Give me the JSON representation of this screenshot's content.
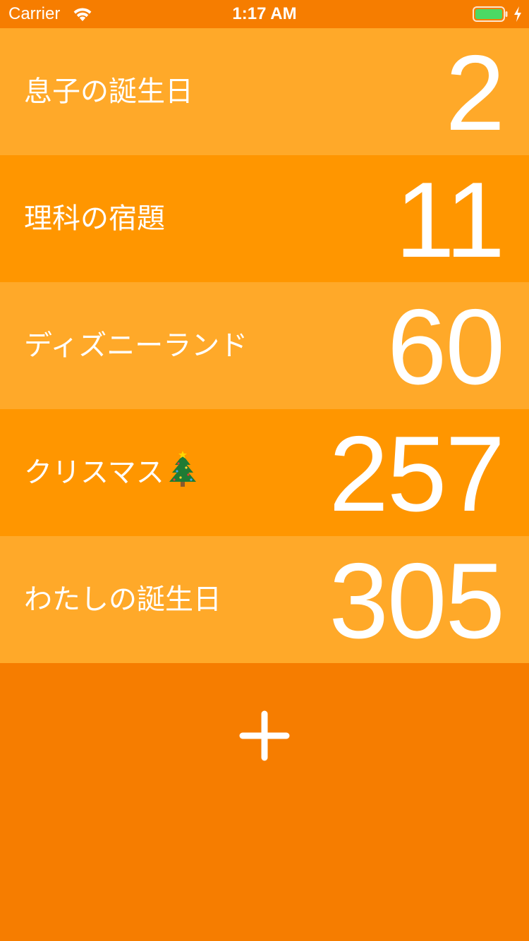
{
  "status_bar": {
    "carrier": "Carrier",
    "time": "1:17 AM",
    "wifi_icon": "wifi-icon",
    "battery_icon": "battery-icon",
    "charging_icon": "charging-bolt-icon",
    "battery_color": "#4CD964"
  },
  "countdowns": [
    {
      "title": "息子の誕生日",
      "days": "2",
      "shade": "light"
    },
    {
      "title": "理科の宿題",
      "days": "11",
      "shade": "dark"
    },
    {
      "title": "ディズニーランド",
      "days": "60",
      "shade": "light"
    },
    {
      "title": "クリスマス",
      "icon": "christmas-tree-icon",
      "days": "257",
      "shade": "dark"
    },
    {
      "title": "わたしの誕生日",
      "days": "305",
      "shade": "light"
    }
  ],
  "add_button": {
    "icon": "plus-icon"
  },
  "colors": {
    "background": "#F67D00",
    "row_light": "#FFA929",
    "row_dark": "#FF9600",
    "text": "#FFFFFF"
  }
}
